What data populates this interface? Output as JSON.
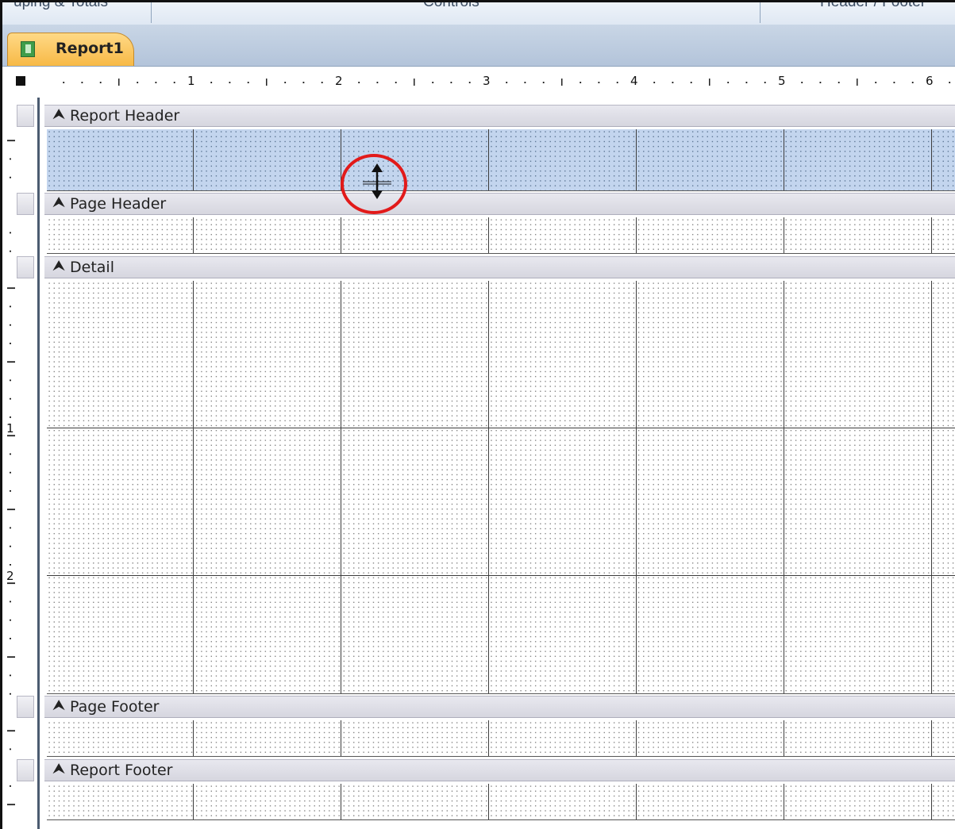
{
  "ribbon": {
    "groups": [
      "uping & Totals",
      "Controls",
      "Header / Footer"
    ]
  },
  "tab": {
    "label": "Report1"
  },
  "ruler": {
    "h_numbers": [
      "1",
      "2",
      "3",
      "4",
      "5",
      "6"
    ],
    "v_numbers": [
      "1",
      "2"
    ]
  },
  "sections": {
    "report_header": "Report Header",
    "page_header": "Page Header",
    "detail": "Detail",
    "page_footer": "Page Footer",
    "report_footer": "Report Footer"
  },
  "icons": {
    "section_chevron": "double-chevron-up-icon",
    "cursor": "resize-vertical-cursor-icon",
    "tab_icon": "report-icon"
  },
  "colors": {
    "selected_section": "#c3d5ee",
    "highlight_ring": "#e21a1a",
    "tab_active": "#f7b946"
  }
}
